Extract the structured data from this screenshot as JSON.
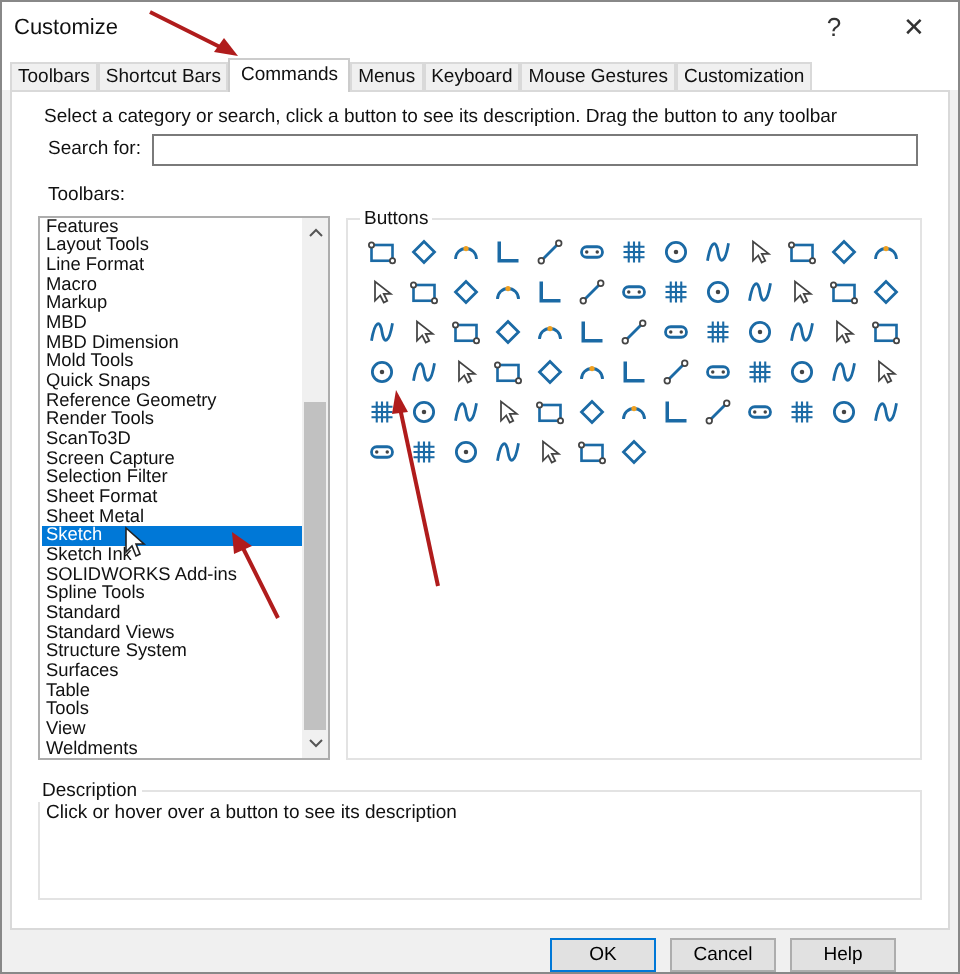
{
  "window": {
    "title": "Customize",
    "help": "?",
    "close": "✕"
  },
  "tabs": [
    {
      "label": "Toolbars",
      "selected": false
    },
    {
      "label": "Shortcut Bars",
      "selected": false
    },
    {
      "label": "Commands",
      "selected": true
    },
    {
      "label": "Menus",
      "selected": false
    },
    {
      "label": "Keyboard",
      "selected": false
    },
    {
      "label": "Mouse Gestures",
      "selected": false
    },
    {
      "label": "Customization",
      "selected": false
    }
  ],
  "instructions": "Select a category or search, click a button to see its description. Drag the button to any toolbar",
  "search": {
    "label": "Search for:"
  },
  "toolbars": {
    "label": "Toolbars:",
    "items": [
      {
        "label": "Features",
        "selected": false
      },
      {
        "label": "Layout Tools",
        "selected": false
      },
      {
        "label": "Line Format",
        "selected": false
      },
      {
        "label": "Macro",
        "selected": false
      },
      {
        "label": "Markup",
        "selected": false
      },
      {
        "label": "MBD",
        "selected": false
      },
      {
        "label": "MBD Dimension",
        "selected": false
      },
      {
        "label": "Mold Tools",
        "selected": false
      },
      {
        "label": "Quick Snaps",
        "selected": false
      },
      {
        "label": "Reference Geometry",
        "selected": false
      },
      {
        "label": "Render Tools",
        "selected": false
      },
      {
        "label": "ScanTo3D",
        "selected": false
      },
      {
        "label": "Screen Capture",
        "selected": false
      },
      {
        "label": "Selection Filter",
        "selected": false
      },
      {
        "label": "Sheet Format",
        "selected": false
      },
      {
        "label": "Sheet Metal",
        "selected": false
      },
      {
        "label": "Sketch",
        "selected": true
      },
      {
        "label": "Sketch Ink",
        "selected": false
      },
      {
        "label": "SOLIDWORKS Add-ins",
        "selected": false
      },
      {
        "label": "Spline Tools",
        "selected": false
      },
      {
        "label": "Standard",
        "selected": false
      },
      {
        "label": "Standard Views",
        "selected": false
      },
      {
        "label": "Structure System",
        "selected": false
      },
      {
        "label": "Surfaces",
        "selected": false
      },
      {
        "label": "Table",
        "selected": false
      },
      {
        "label": "Tools",
        "selected": false
      },
      {
        "label": "View",
        "selected": false
      },
      {
        "label": "Weldments",
        "selected": false
      }
    ]
  },
  "buttons_group": {
    "title": "Buttons"
  },
  "description": {
    "title": "Description",
    "text": "Click or hover over a button to see its description"
  },
  "dialog_buttons": [
    {
      "label": "OK",
      "default": true
    },
    {
      "label": "Cancel",
      "default": false
    },
    {
      "label": "Help",
      "default": false
    }
  ]
}
